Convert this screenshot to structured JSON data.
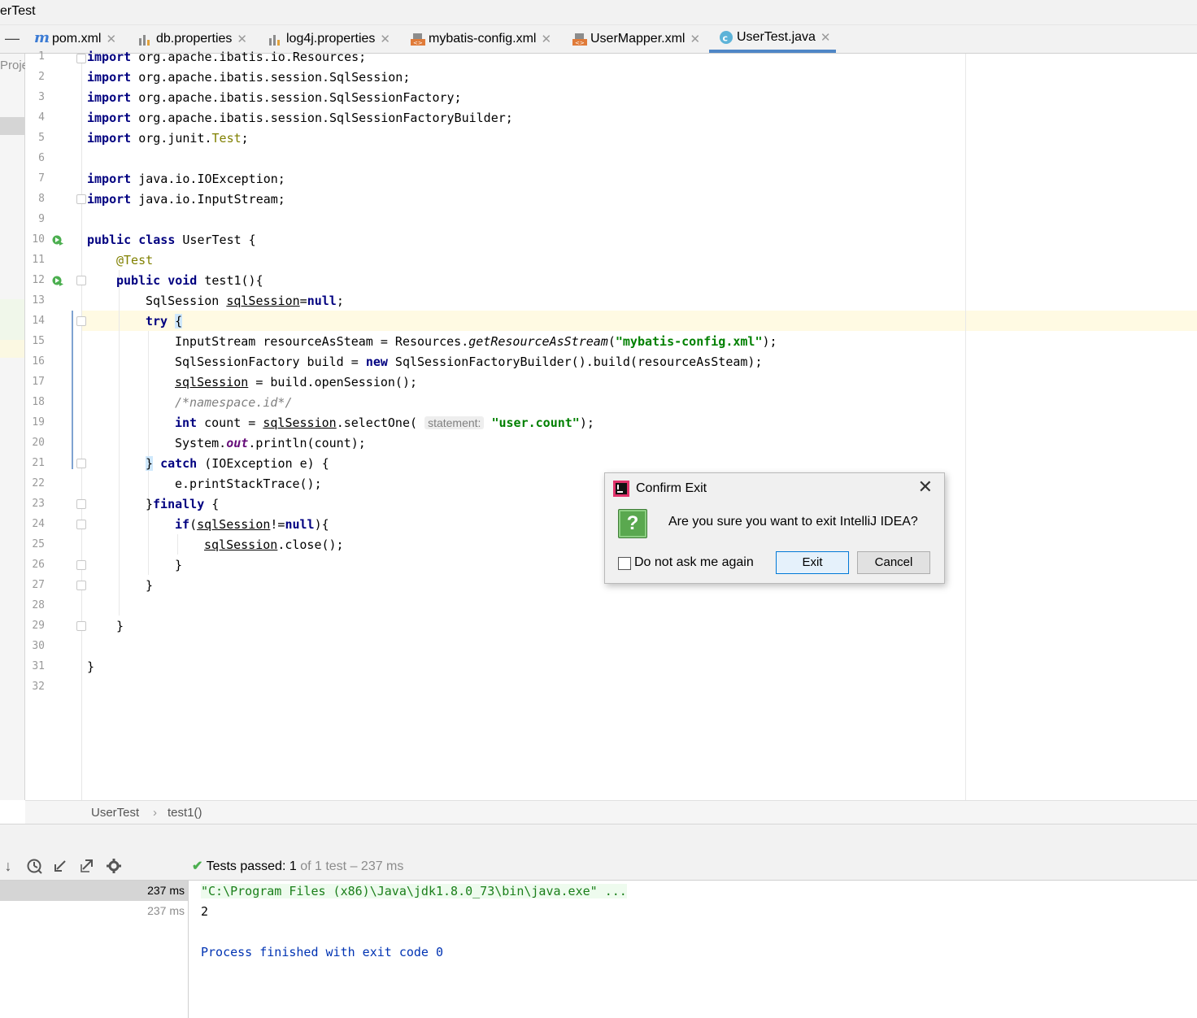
{
  "window": {
    "title_fragment": "erTest"
  },
  "tabs": [
    {
      "label": "pom.xml",
      "icon": "maven-icon"
    },
    {
      "label": "db.properties",
      "icon": "properties-icon"
    },
    {
      "label": "log4j.properties",
      "icon": "properties-icon"
    },
    {
      "label": "mybatis-config.xml",
      "icon": "xml-icon"
    },
    {
      "label": "UserMapper.xml",
      "icon": "xml-icon"
    },
    {
      "label": "UserTest.java",
      "icon": "java-class-icon",
      "active": true
    }
  ],
  "left_panel_label": "Proje",
  "editor": {
    "line_numbers": [
      "1",
      "2",
      "3",
      "4",
      "5",
      "6",
      "7",
      "8",
      "9",
      "10",
      "11",
      "12",
      "13",
      "14",
      "15",
      "16",
      "17",
      "18",
      "19",
      "20",
      "21",
      "22",
      "23",
      "24",
      "25",
      "26",
      "27",
      "28",
      "29",
      "30",
      "31",
      "32"
    ],
    "imports": [
      {
        "kw": "import",
        "path": "org.apache.ibatis.io.Resources;"
      },
      {
        "kw": "import",
        "path": "org.apache.ibatis.session.SqlSession;"
      },
      {
        "kw": "import",
        "path": "org.apache.ibatis.session.SqlSessionFactory;"
      },
      {
        "kw": "import",
        "path": "org.apache.ibatis.session.SqlSessionFactoryBuilder;"
      },
      {
        "kw": "import",
        "path": "org.junit.",
        "suffix": "Test",
        "end": ";"
      },
      {
        "kw": "import",
        "path": "java.io.IOException;"
      },
      {
        "kw": "import",
        "path": "java.io.InputStream;"
      }
    ],
    "class_line": {
      "kw1": "public",
      "kw2": "class",
      "name": "UserTest {"
    },
    "annotation": "@Test",
    "method_line": {
      "kw1": "public",
      "kw2": "void",
      "name": "test1(){"
    },
    "decl_line": {
      "type": "SqlSession ",
      "var": "sqlSession",
      "eq": "=",
      "null": "null",
      "end": ";"
    },
    "try_kw": "try",
    "brace_open": "{",
    "stream_line": {
      "a": "InputStream resourceAsSteam = Resources.",
      "method": "getResourceAsStream",
      "b": "(",
      "str": "\"mybatis-config.xml\"",
      "c": ");"
    },
    "factory_line": {
      "a": "SqlSessionFactory build = ",
      "new": "new",
      "b": " SqlSessionFactoryBuilder().build(resourceAsSteam);"
    },
    "open_line": {
      "var": "sqlSession",
      "rest": " = build.openSession();"
    },
    "comment": "/*namespace.id*/",
    "count_line": {
      "kw": "int",
      "a": " count = ",
      "var": "sqlSession",
      "b": ".selectOne(",
      "hint": "statement:",
      "str": "\"user.count\"",
      "c": ");"
    },
    "println_line": {
      "a": "System.",
      "field": "out",
      "b": ".println(count);"
    },
    "catch_line": {
      "brace": "}",
      "kw": "catch",
      "rest": " (IOException e) {"
    },
    "trace_line": "e.printStackTrace();",
    "finally_line": {
      "brace": "}",
      "kw": "finally",
      "rest": " {"
    },
    "if_line": {
      "kw": "if",
      "a": "(",
      "var": "sqlSession",
      "b": "!=",
      "null": "null",
      "c": "){"
    },
    "close_line": {
      "var": "sqlSession",
      "rest": ".close();"
    },
    "close_brace": "}"
  },
  "breadcrumb": {
    "class": "UserTest",
    "sep": "›",
    "method": "test1()"
  },
  "test_status": {
    "label": "Tests passed:",
    "passed": "1",
    "of_text": "of 1 test – 237 ms"
  },
  "test_tree": {
    "row1_time": "237 ms",
    "row2_time": "237 ms"
  },
  "console": {
    "command": "\"C:\\Program Files (x86)\\Java\\jdk1.8.0_73\\bin\\java.exe\" ...",
    "output": "2",
    "exit": "Process finished with exit code 0"
  },
  "dialog": {
    "title": "Confirm Exit",
    "close_glyph": "✕",
    "icon_glyph": "?",
    "message": "Are you sure you want to exit IntelliJ IDEA?",
    "checkbox_label": "Do not ask me again",
    "exit_label": "Exit",
    "cancel_label": "Cancel"
  },
  "colors": {
    "keyword": "#000080",
    "string": "#008000",
    "annotation": "#808000",
    "accent": "#4f86c6"
  }
}
